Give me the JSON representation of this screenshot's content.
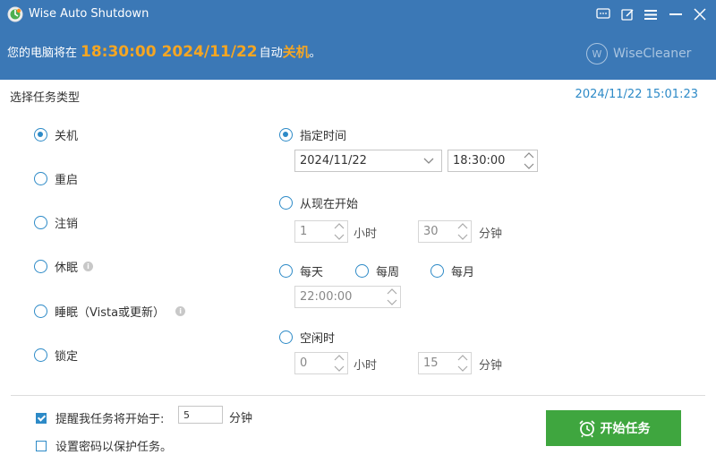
{
  "window": {
    "title": "Wise Auto Shutdown"
  },
  "header": {
    "prefix": "您的电脑将在",
    "time": "18:30:00",
    "date": "2024/11/22",
    "mid": "自动",
    "action": "关机",
    "suffix": "。",
    "brand": "WiseCleaner",
    "brand_badge": "W"
  },
  "section_label": "选择任务类型",
  "clock": "2024/11/22 15:01:23",
  "task_types": {
    "shutdown": "关机",
    "restart": "重启",
    "logoff": "注销",
    "hibernate": "休眠",
    "sleep": "睡眠（Vista或更新）",
    "lock": "锁定",
    "selected": "shutdown"
  },
  "schedule": {
    "specified_label": "指定时间",
    "specified_date": "2024/11/22",
    "specified_time": "18:30:00",
    "from_now_label": "从现在开始",
    "from_now_hours": "1",
    "from_now_minutes": "30",
    "daily_label": "每天",
    "weekly_label": "每周",
    "monthly_label": "每月",
    "repeat_time": "22:00:00",
    "idle_label": "空闲时",
    "idle_hours": "0",
    "idle_minutes": "15",
    "unit_hours": "小时",
    "unit_minutes": "分钟",
    "selected": "specified"
  },
  "footer": {
    "remind_label": "提醒我任务将开始于:",
    "remind_value": "5",
    "remind_unit": "分钟",
    "remind_checked": true,
    "password_label": "设置密码以保护任务。",
    "password_checked": false,
    "start_button": "开始任务"
  },
  "colors": {
    "header_bg": "#3b78b6",
    "accent": "#2d8ac7",
    "highlight": "#f5a623",
    "start_button": "#3fa63f"
  },
  "icons": [
    "app-logo-icon",
    "feedback-icon",
    "edit-icon",
    "menu-icon",
    "minimize-icon",
    "close-icon",
    "info-icon",
    "chevron-down-icon",
    "spinner-icon",
    "alarm-clock-icon"
  ]
}
